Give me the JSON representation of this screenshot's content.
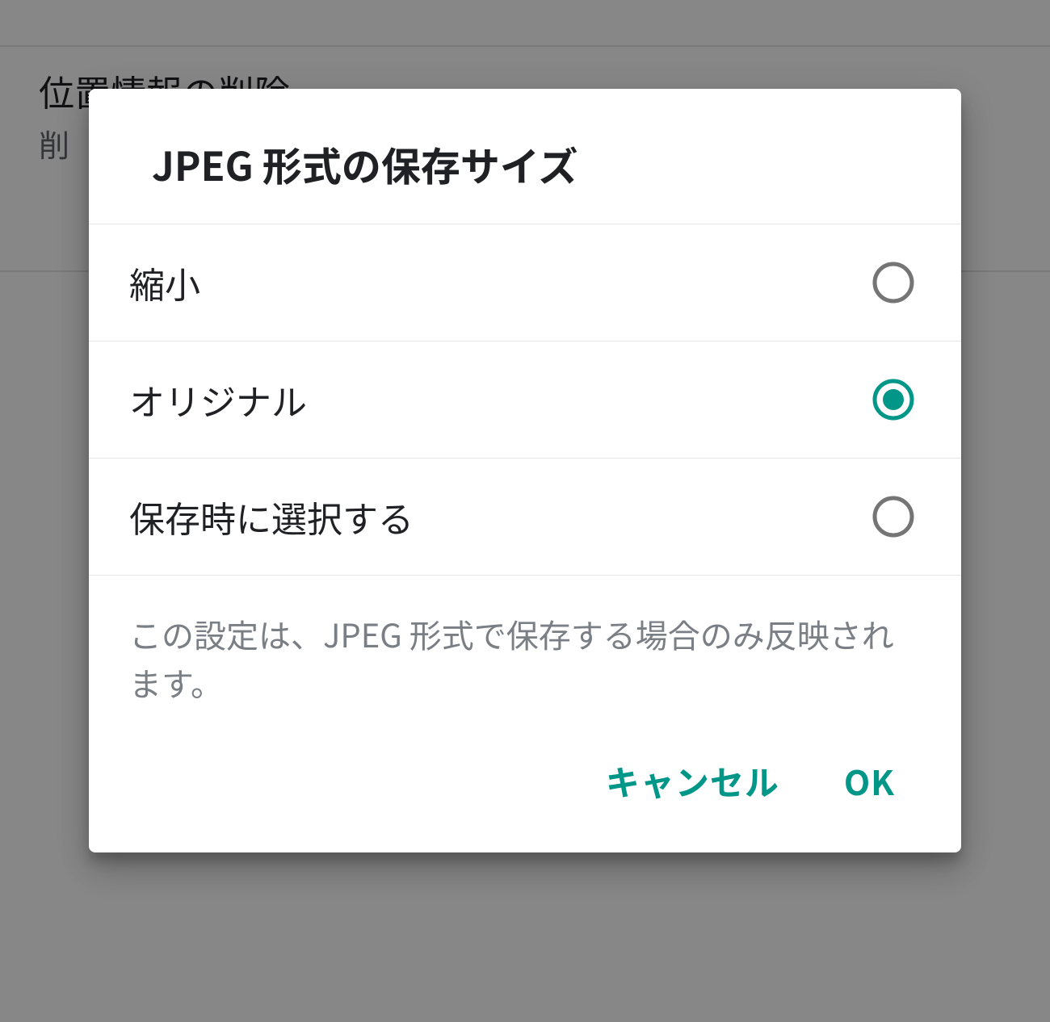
{
  "background": {
    "setting_title": "位置情報の削除",
    "setting_sub_prefix": "削"
  },
  "dialog": {
    "title": "JPEG 形式の保存サイズ",
    "options": [
      {
        "label": "縮小",
        "selected": false
      },
      {
        "label": "オリジナル",
        "selected": true
      },
      {
        "label": "保存時に選択する",
        "selected": false
      }
    ],
    "helper": "この設定は、JPEG 形式で保存する場合のみ反映されます。",
    "buttons": {
      "cancel": "キャンセル",
      "ok": "OK"
    },
    "colors": {
      "accent": "#009688",
      "radio_off": "#757575"
    }
  }
}
